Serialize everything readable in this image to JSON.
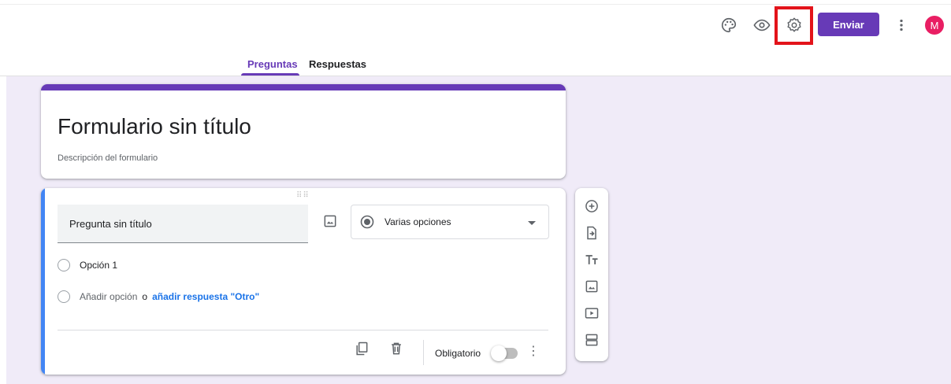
{
  "header": {
    "send_label": "Enviar",
    "avatar_initial": "M",
    "icons": [
      "palette-icon",
      "eye-icon",
      "gear-icon",
      "more-vert-icon"
    ],
    "highlight_color": "#e3131a",
    "accent": "#673ab7"
  },
  "tabs": [
    {
      "label": "Preguntas",
      "active": true
    },
    {
      "label": "Respuestas",
      "active": false
    }
  ],
  "form": {
    "title": "Formulario sin título",
    "description": "Descripción del formulario"
  },
  "question": {
    "title": "Pregunta sin título",
    "type": "Varias opciones",
    "options": [
      "Opción 1"
    ],
    "add_option": "Añadir opción",
    "or": "o",
    "add_other": "añadir respuesta \"Otro\"",
    "required_label": "Obligatorio",
    "required": false
  },
  "side_toolbar": {
    "icons": [
      "add-question-icon",
      "import-questions-icon",
      "add-title-icon",
      "add-image-icon",
      "add-video-icon",
      "add-section-icon"
    ]
  }
}
